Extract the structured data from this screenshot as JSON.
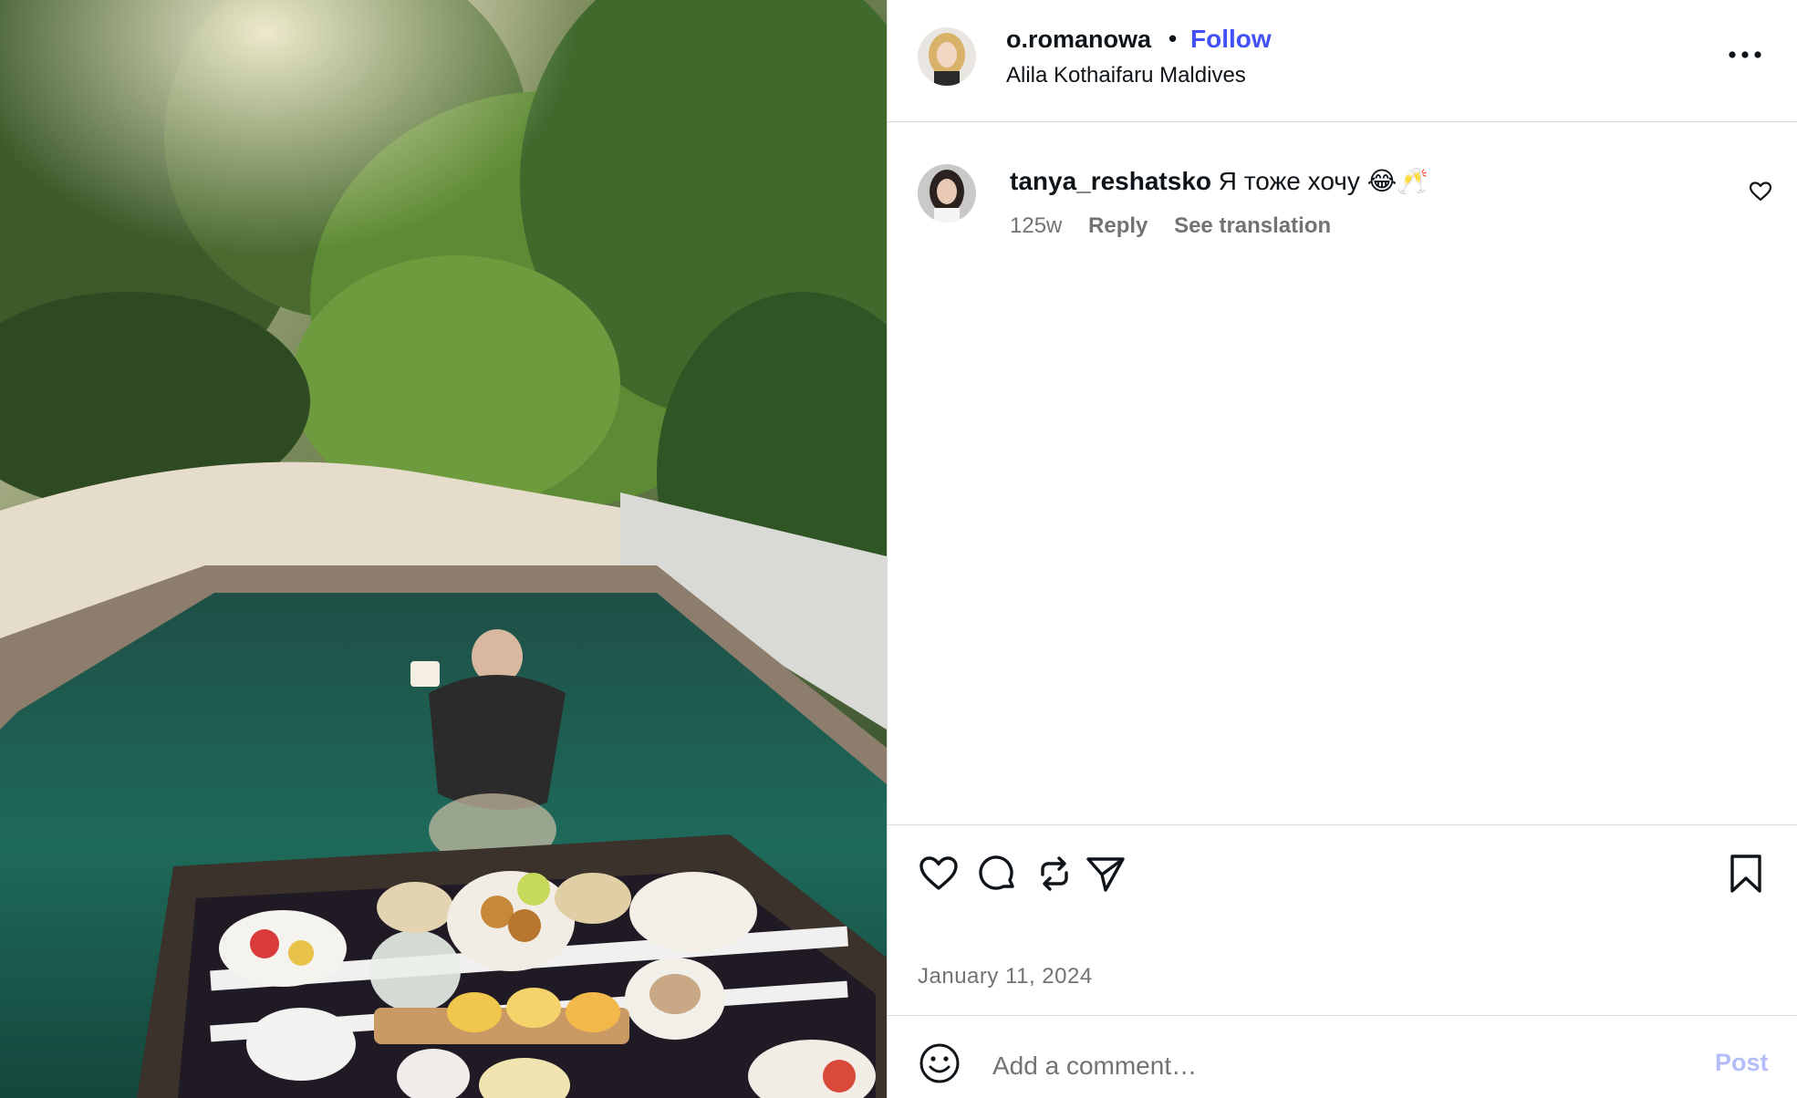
{
  "post": {
    "author": {
      "username": "o.romanowa",
      "separator": "•",
      "follow_label": "Follow",
      "location": "Alila Kothaifaru Maldives",
      "avatar": "avatar-blonde-woman"
    },
    "photo": {
      "subject": "woman-floating-in-pool-with-breakfast-tray"
    },
    "more_icon": "more-horizontal-icon",
    "colors": {
      "follow": "#4150f7",
      "muted": "#737373",
      "post_disabled": "#b3bdf7",
      "divider": "#dbdbdb"
    }
  },
  "comments": [
    {
      "username": "tanya_reshatsko",
      "text": "Я тоже хочу 😂🥂",
      "time": "125w",
      "reply_label": "Reply",
      "translate_label": "See translation",
      "avatar": "avatar-dark-hair-woman",
      "like_icon": "heart-icon"
    }
  ],
  "actions": {
    "like_icon": "heart-icon",
    "comment_icon": "comment-icon",
    "repost_icon": "repost-icon",
    "share_icon": "send-icon",
    "save_icon": "bookmark-icon"
  },
  "date": "January 11, 2024",
  "composer": {
    "emoji_icon": "smiley-icon",
    "placeholder": "Add a comment…",
    "post_label": "Post"
  }
}
